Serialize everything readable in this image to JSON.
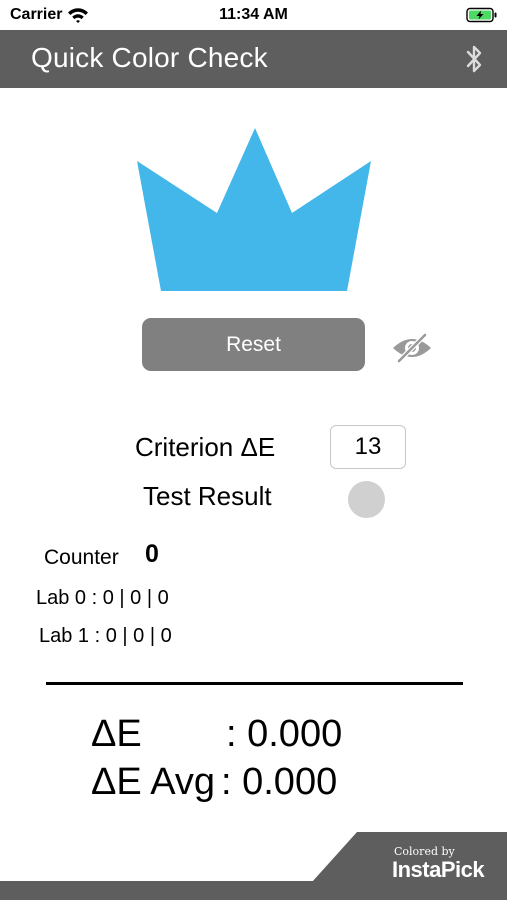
{
  "status_bar": {
    "carrier": "Carrier",
    "time": "11:34 AM",
    "battery_color": "#4cd964"
  },
  "header": {
    "title": "Quick Color Check",
    "background": "#5e5e5e"
  },
  "crown": {
    "color": "#43b6ea",
    "icon": "crown-icon"
  },
  "controls": {
    "reset_label": "Reset",
    "visibility_icon": "eye-slash-icon"
  },
  "criterion": {
    "label": "Criterion ΔE",
    "value": "13"
  },
  "test_result": {
    "label": "Test Result",
    "indicator_color": "#d0d0d0"
  },
  "counter": {
    "label": "Counter",
    "value": "0"
  },
  "lab": {
    "lab0": "Lab 0 : 0 | 0 | 0",
    "lab1": "Lab 1 : 0 | 0 | 0"
  },
  "delta": {
    "de_label": "ΔE",
    "de_value": ": 0.000",
    "avg_label": "ΔE Avg",
    "avg_value": ": 0.000"
  },
  "footer": {
    "tagline": "Colored by",
    "brand": "InstaPick"
  }
}
